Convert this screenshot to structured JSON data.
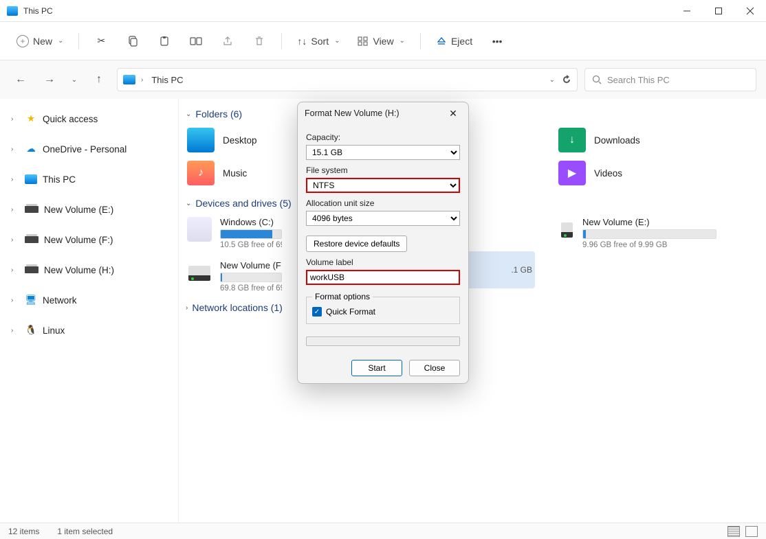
{
  "title": "This PC",
  "toolbar": {
    "new_label": "New",
    "sort_label": "Sort",
    "view_label": "View",
    "eject_label": "Eject"
  },
  "breadcrumb": {
    "location": "This PC"
  },
  "search": {
    "placeholder": "Search This PC"
  },
  "sidebar": {
    "items": [
      {
        "label": "Quick access"
      },
      {
        "label": "OneDrive - Personal"
      },
      {
        "label": "This PC"
      },
      {
        "label": "New Volume (E:)"
      },
      {
        "label": "New Volume (F:)"
      },
      {
        "label": "New Volume (H:)"
      },
      {
        "label": "Network"
      },
      {
        "label": "Linux"
      }
    ]
  },
  "sections": {
    "folders": {
      "title": "Folders (6)"
    },
    "drives": {
      "title": "Devices and drives (5)"
    },
    "network": {
      "title": "Network locations (1)"
    }
  },
  "folders": [
    {
      "name": "Desktop"
    },
    {
      "name": "Downloads"
    },
    {
      "name": "Music"
    },
    {
      "name": "Videos"
    }
  ],
  "drives": [
    {
      "name": "Windows (C:)",
      "sub": "10.5 GB free of 69.",
      "fill": 85
    },
    {
      "name": "New Volume (E:)",
      "sub": "9.96 GB free of 9.99 GB",
      "fill": 2
    },
    {
      "name": "New Volume (F:)",
      "sub": "69.8 GB free of 69.",
      "fill": 2
    },
    {
      "name_partial": ".1 GB"
    }
  ],
  "dialog": {
    "title": "Format New Volume (H:)",
    "capacity_label": "Capacity:",
    "capacity_value": "15.1 GB",
    "fs_label": "File system",
    "fs_value": "NTFS",
    "alloc_label": "Allocation unit size",
    "alloc_value": "4096 bytes",
    "restore_label": "Restore device defaults",
    "vol_label": "Volume label",
    "vol_value": "workUSB",
    "fmt_legend": "Format options",
    "quick_label": "Quick Format",
    "start_label": "Start",
    "close_label": "Close"
  },
  "status": {
    "items": "12 items",
    "selected": "1 item selected"
  }
}
